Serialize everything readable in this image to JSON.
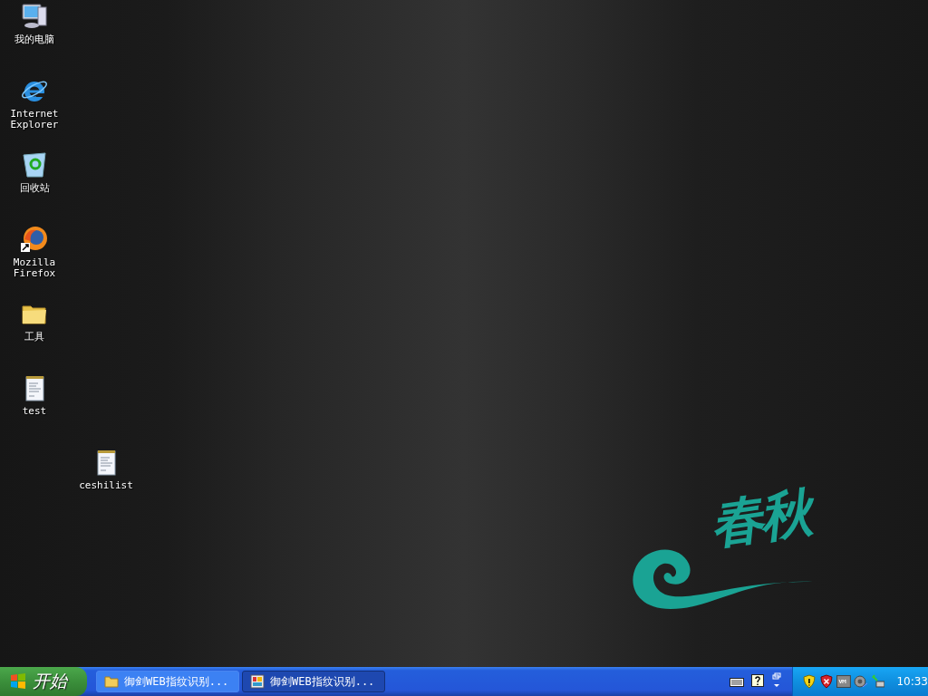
{
  "desktop_icons": [
    {
      "label": "我的电脑",
      "kind": "computer"
    },
    {
      "label": "Internet\nExplorer",
      "kind": "browser-e"
    },
    {
      "label": "回收站",
      "kind": "recycle"
    },
    {
      "label": "Mozilla\nFirefox",
      "kind": "firefox"
    },
    {
      "label": "工具",
      "kind": "folder"
    },
    {
      "label": "test",
      "kind": "notepad"
    },
    {
      "label": "ceshilist",
      "kind": "notepad"
    }
  ],
  "wallpaper": {
    "logo_text": "春秋"
  },
  "taskbar": {
    "start_label": "开始",
    "tasks": [
      {
        "label": "御剑WEB指纹识别...",
        "kind": "folder",
        "selected": false
      },
      {
        "label": "御剑WEB指纹识别...",
        "kind": "app",
        "selected": true
      }
    ],
    "clock": "10:33"
  }
}
